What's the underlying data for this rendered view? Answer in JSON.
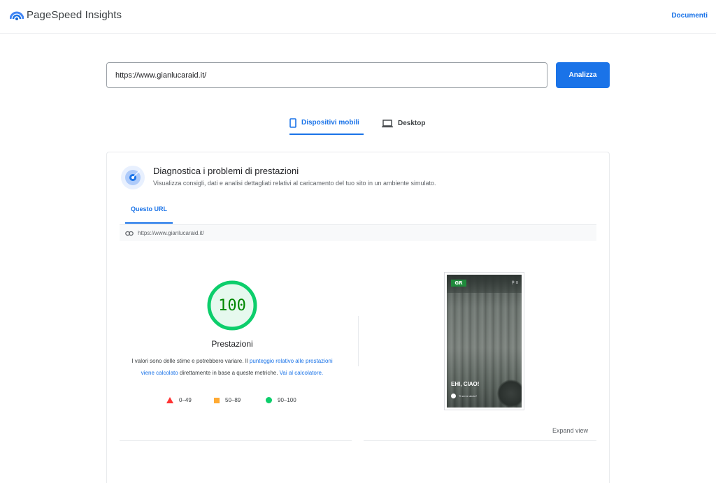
{
  "header": {
    "brand": "PageSpeed Insights",
    "docs_link": "Documenti"
  },
  "search": {
    "url_value": "https://www.gianlucaraid.it/",
    "analyze_label": "Analizza"
  },
  "device_tabs": {
    "mobile_label": "Dispositivi mobili",
    "desktop_label": "Desktop",
    "selected": "mobile"
  },
  "diagnostics": {
    "title": "Diagnostica i problemi di prestazioni",
    "subtitle": "Visualizza consigli, dati e analisi dettagliati relativi al caricamento del tuo sito in un ambiente simulato.",
    "tab_label": "Questo URL",
    "tested_url": "https://www.gianlucaraid.it/"
  },
  "score": {
    "value": "100",
    "label": "Prestazioni",
    "desc_part1": "I valori sono delle stime e potrebbero variare. Il ",
    "desc_link1": "punteggio relativo alle prestazioni viene calcolato",
    "desc_part2": " direttamente in base a queste metriche. ",
    "desc_link2": "Vai al calcolatore.",
    "color": "#0cce6b"
  },
  "legend": {
    "fail": "0–49",
    "average": "50–89",
    "pass": "90–100"
  },
  "screenshot": {
    "logo_text": "GR",
    "headline": "EHI, CIAO!",
    "sub_text": "Ti serve aiuto?"
  },
  "expand_label": "Expand view",
  "colors": {
    "accent": "#1a73e8",
    "pass": "#0cce6b",
    "average": "#ffaa33",
    "fail": "#ff3333"
  }
}
